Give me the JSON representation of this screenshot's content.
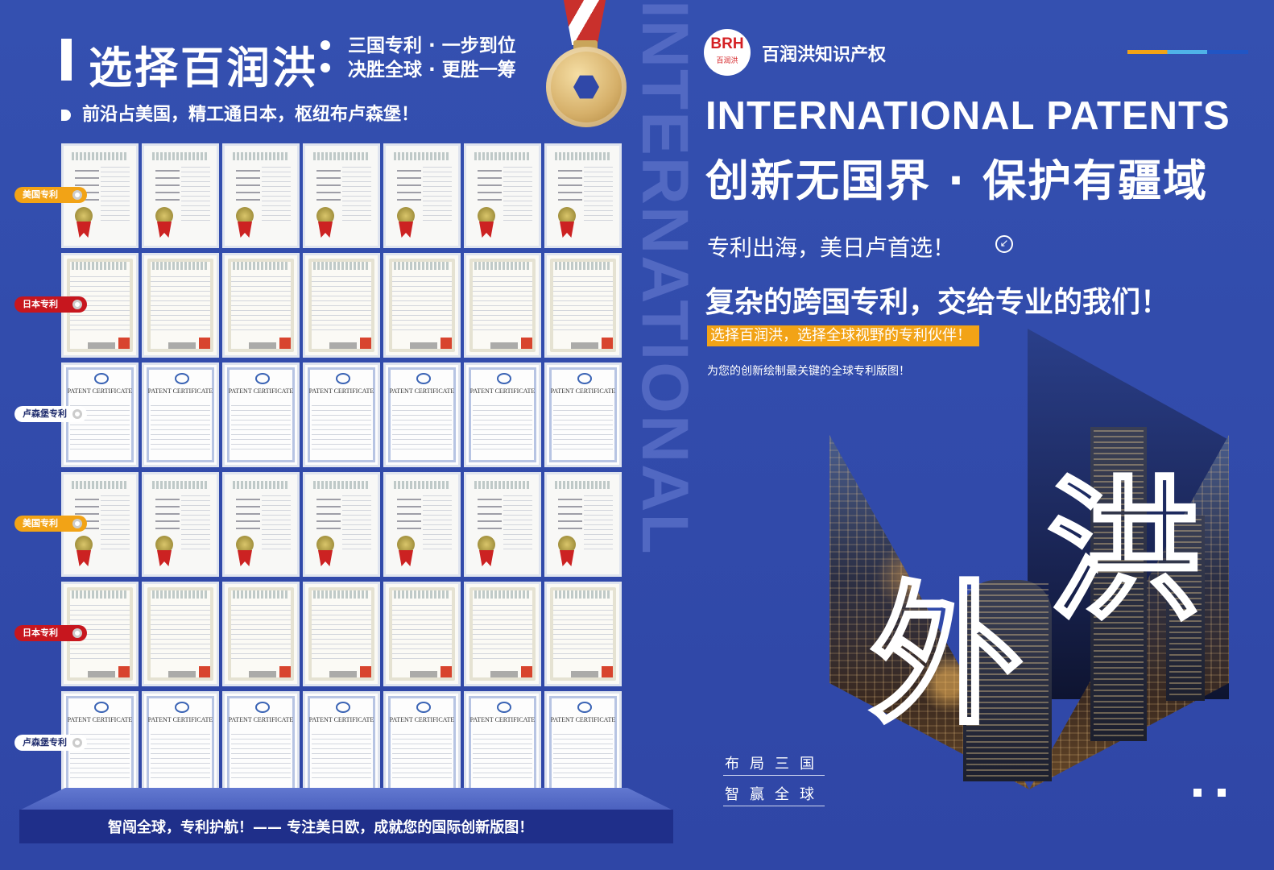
{
  "header": {
    "main_title": "选择百润洪",
    "sub_line1": "三国专利 · 一步到位",
    "sub_line2": "决胜全球 · 更胜一筹",
    "lead": "前沿占美国，精工通日本，枢纽布卢森堡！"
  },
  "vertical_word": "INTERNATIONAL",
  "wall": {
    "rows": [
      {
        "type": "us",
        "tag": "美国专利"
      },
      {
        "type": "jp",
        "tag": "日本专利"
      },
      {
        "type": "pct",
        "tag": "卢森堡专利"
      },
      {
        "type": "us",
        "tag": "美国专利"
      },
      {
        "type": "jp",
        "tag": "日本专利"
      },
      {
        "type": "pct",
        "tag": "卢森堡专利"
      }
    ],
    "pct_text": "PATENT CERTIFICATE"
  },
  "footer": {
    "text": "智闯全球，专利护航！—— 专注美日欧，成就您的国际创新版图！"
  },
  "brand": {
    "logo_mark": "BRH",
    "logo_sub": "百润洪",
    "name": "百润洪知识产权"
  },
  "right": {
    "en_title": "INTERNATIONAL PATENTS",
    "cn_title": "创新无国界 · 保护有疆域",
    "line1": "专利出海，美日卢首选！",
    "line2": "复杂的跨国专利，交给专业的我们！",
    "highlight": "选择百润洪，选择全球视野的专利伙伴！",
    "small_line": "为您的创新绘制最关键的全球专利版图！",
    "char1": "外",
    "char2": "洪",
    "slogan1": "布局三国",
    "slogan2": "智赢全球"
  },
  "colors": {
    "background": "#3048a8",
    "accent_orange": "#f2a316",
    "accent_red": "#c7161e",
    "footer_band": "#1f2f8a"
  }
}
